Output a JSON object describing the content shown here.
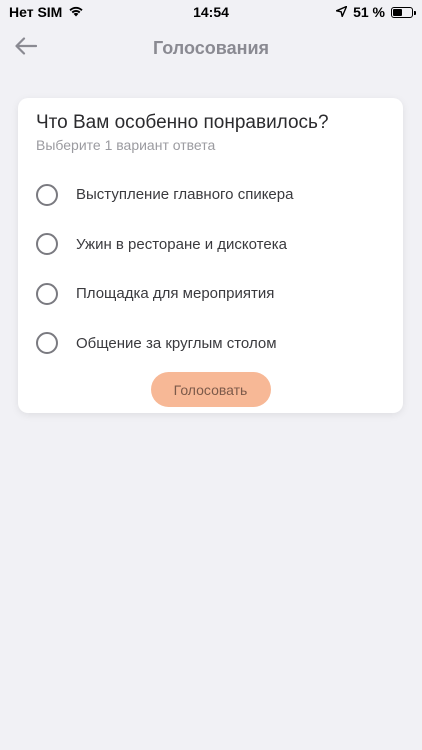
{
  "status_bar": {
    "carrier": "Нет SIM",
    "time": "14:54",
    "battery_text": "51 %",
    "battery_level": 0.51
  },
  "header": {
    "title": "Голосования"
  },
  "poll": {
    "question": "Что Вам особенно понравилось?",
    "hint": "Выберите 1 вариант ответа",
    "options": [
      {
        "label": "Выступление главного спикера"
      },
      {
        "label": "Ужин в ресторане и дискотека"
      },
      {
        "label": "Площадка для мероприятия"
      },
      {
        "label": "Общение за круглым столом"
      }
    ],
    "vote_label": "Голосовать"
  }
}
